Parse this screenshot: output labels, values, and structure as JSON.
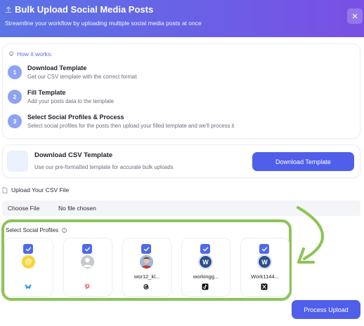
{
  "header": {
    "title": "Bulk Upload Social Media Posts",
    "subtitle": "Streamline your workflow by uploading multiple social media posts at once",
    "close_label": "✕",
    "icon": "upload-icon"
  },
  "how_it_works": {
    "title": "How it works:",
    "icon": "lightbulb-icon",
    "steps": [
      {
        "number": "1",
        "title": "Download Template",
        "description": "Get our CSV template with the correct format"
      },
      {
        "number": "2",
        "title": "Fill Template",
        "description": "Add your posts data to the template"
      },
      {
        "number": "3",
        "title": "Select Social Profiles & Process",
        "description": "Select social profiles for the posts then upload your filled template and we'll process it"
      }
    ]
  },
  "download": {
    "title": "Download CSV Template",
    "description": "Use our pre-formatted template for accurate bulk uploads",
    "button_label": "Download Template"
  },
  "upload": {
    "label": "Upload Your CSV File",
    "choose_label": "Choose File",
    "status": "No file chosen"
  },
  "profiles": {
    "label": "Select Social Profiles",
    "items": [
      {
        "name": "",
        "platform": "bluesky-icon",
        "avatar": "at-sign-avatar",
        "checked": true
      },
      {
        "name": "",
        "platform": "pinterest-icon",
        "avatar": "default-user-avatar",
        "checked": true
      },
      {
        "name": "wor12_kl...",
        "platform": "threads-icon",
        "avatar": "photo-avatar",
        "checked": true
      },
      {
        "name": "workingg...",
        "platform": "tiktok-icon",
        "avatar": "letter-w-avatar",
        "checked": true
      },
      {
        "name": "Work1144...",
        "platform": "x-icon",
        "avatar": "letter-w-avatar",
        "checked": true
      }
    ],
    "avatar_letter": "W"
  },
  "process_button_label": "Process Upload",
  "colors": {
    "header_start": "#5b74e6",
    "header_end": "#7a4fe4",
    "primary": "#4f5fe9",
    "highlight": "#8cc455"
  }
}
